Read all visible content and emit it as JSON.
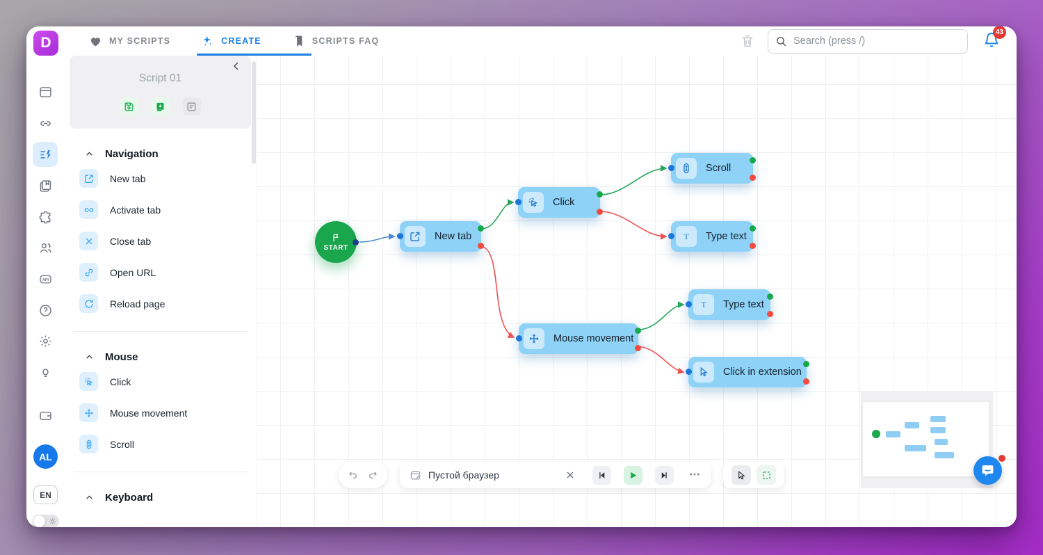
{
  "app": {
    "logo_letter": "D"
  },
  "topbar": {
    "tabs": [
      {
        "label": "MY SCRIPTS",
        "active": false
      },
      {
        "label": "CREATE",
        "active": true
      },
      {
        "label": "SCRIPTS FAQ",
        "active": false
      }
    ],
    "search_placeholder": "Search (press /)",
    "notifications_count": "43"
  },
  "rail": {
    "avatar_initials": "AL",
    "language": "EN",
    "api_label": "API"
  },
  "script_panel": {
    "title": "Script 01",
    "sections": [
      {
        "title": "Navigation",
        "items": [
          {
            "label": "New tab"
          },
          {
            "label": "Activate tab"
          },
          {
            "label": "Close tab"
          },
          {
            "label": "Open URL"
          },
          {
            "label": "Reload page"
          }
        ]
      },
      {
        "title": "Mouse",
        "items": [
          {
            "label": "Click"
          },
          {
            "label": "Mouse movement"
          },
          {
            "label": "Scroll"
          }
        ]
      },
      {
        "title": "Keyboard",
        "items": []
      }
    ]
  },
  "canvas": {
    "start_label": "START",
    "nodes": [
      {
        "label": "New tab"
      },
      {
        "label": "Click"
      },
      {
        "label": "Scroll"
      },
      {
        "label": "Type text"
      },
      {
        "label": "Mouse movement"
      },
      {
        "label": "Type text"
      },
      {
        "label": "Click in extension"
      }
    ]
  },
  "toolbar": {
    "browser_label": "Пустой браузер",
    "more_label": "⋯"
  },
  "icons": {
    "heart-icon": "♥ filled heart",
    "sparkles-icon": "✦ magic star with x marks",
    "bookmark-icon": "solid book",
    "trash-icon": "trash can outline",
    "search-icon": "magnifier",
    "bell-icon": "notification bell",
    "chevron-left-icon": "‹",
    "caret-up-icon": "^",
    "save-icon": "floppy disk",
    "apply-template-icon": "green filled clipboard with arrow",
    "notes-icon": "document with lines",
    "new-tab-icon": "square with external arrow",
    "activate-tab-icon": "chain link",
    "close-tab-icon": "✕",
    "open-url-icon": "tilted chain link",
    "reload-page-icon": "circular arrow",
    "click-icon": "pointer with rays",
    "mouse-movement-icon": "four direction arrows",
    "scroll-icon": "mouse wheel with arrows",
    "type-text-icon": "serif T",
    "click-extension-icon": "cursor arrow",
    "flag-icon": "start flag",
    "undo-icon": "curved arrow left",
    "redo-icon": "curved arrow right",
    "skip-back-icon": "bar + left triangle",
    "play-icon": "green triangle",
    "skip-forward-icon": "right triangle + bar",
    "cursor-mode-icon": "arrow cursor",
    "select-mode-icon": "green dashed selection square",
    "chat-icon": "speech bubble with smile",
    "sun-icon": "theme sun"
  },
  "colors": {
    "accent_blue": "#1b7fe4",
    "node_blue": "#8fd2f7",
    "green": "#17a94a",
    "red": "#f4493d",
    "edge_blue": "#4b8bd5",
    "logo_purple": "#b53ae2",
    "badge_red": "#e53935",
    "avatar_blue": "#1778e9"
  }
}
